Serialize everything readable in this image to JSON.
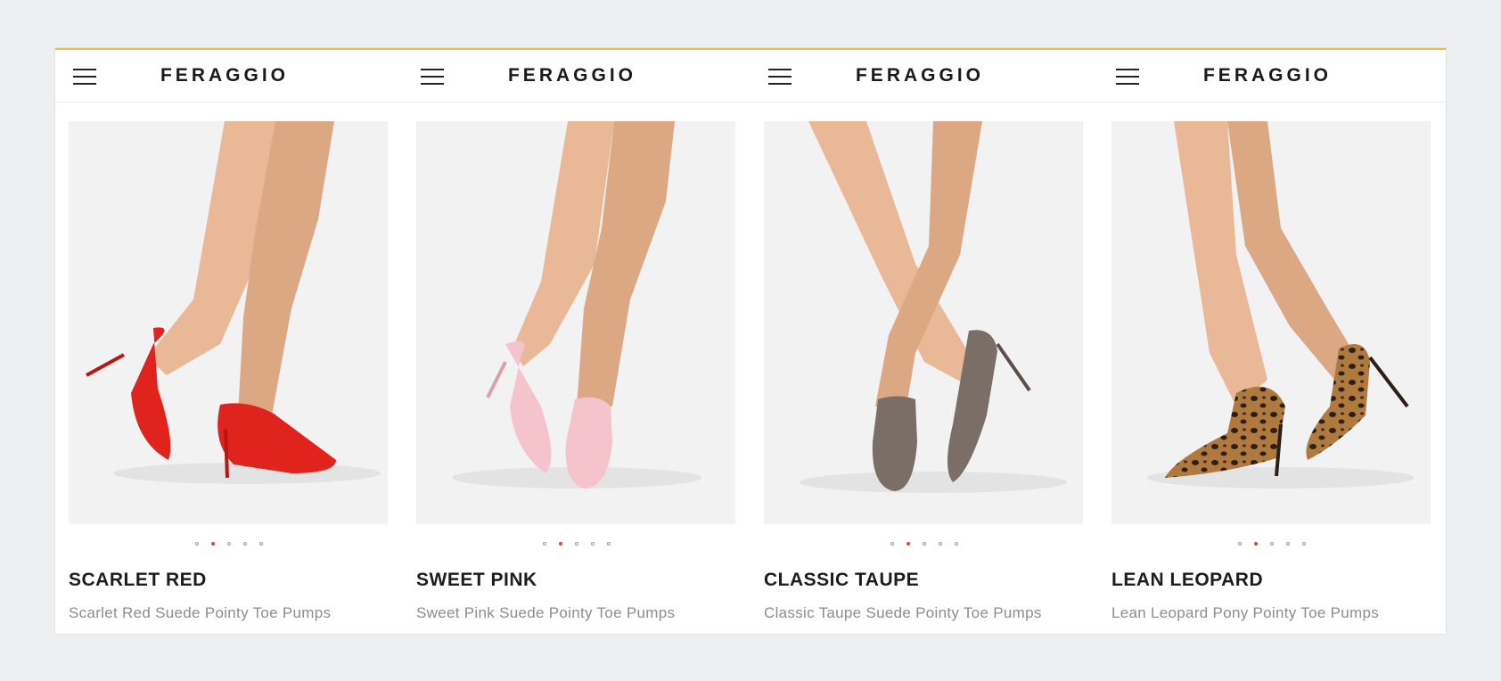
{
  "brand": "FERAGGIO",
  "products": [
    {
      "name": "SCARLET RED",
      "description": "Scarlet Red Suede Pointy Toe Pumps",
      "shoe_color": "#e0231c",
      "shoe_dark": "#b8160f",
      "pattern": "solid",
      "carousel": {
        "count": 5,
        "active": 2
      }
    },
    {
      "name": "SWEET PINK",
      "description": "Sweet Pink Suede Pointy Toe Pumps",
      "shoe_color": "#f4c3cc",
      "shoe_dark": "#dd9fab",
      "pattern": "solid",
      "carousel": {
        "count": 5,
        "active": 2
      }
    },
    {
      "name": "CLASSIC TAUPE",
      "description": "Classic Taupe Suede Pointy Toe Pumps",
      "shoe_color": "#7a6e66",
      "shoe_dark": "#5a4f49",
      "pattern": "solid",
      "carousel": {
        "count": 5,
        "active": 2
      }
    },
    {
      "name": "LEAN LEOPARD",
      "description": "Lean Leopard Pony Pointy Toe Pumps",
      "shoe_color": "#b07a3e",
      "shoe_dark": "#2c1f16",
      "pattern": "leopard",
      "carousel": {
        "count": 5,
        "active": 2
      }
    }
  ],
  "colors": {
    "accent": "#e8412a",
    "top_border": "#e3c04a",
    "skin": "#e9b896",
    "skin_shadow": "#cf9673"
  },
  "icons": {
    "menu": "hamburger-menu-icon"
  }
}
